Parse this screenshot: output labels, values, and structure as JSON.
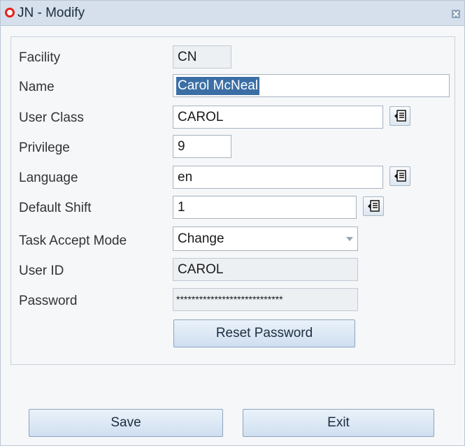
{
  "window": {
    "title": "JN - Modify"
  },
  "form": {
    "facility": {
      "label": "Facility",
      "value": "CN"
    },
    "name": {
      "label": "Name",
      "value": "Carol McNeal"
    },
    "user_class": {
      "label": "User Class",
      "value": "CAROL"
    },
    "privilege": {
      "label": "Privilege",
      "value": "9"
    },
    "language": {
      "label": "Language",
      "value": "en"
    },
    "default_shift": {
      "label": "Default Shift",
      "value": "1"
    },
    "task_accept_mode": {
      "label": "Task Accept Mode",
      "value": "Change"
    },
    "user_id": {
      "label": "User ID",
      "value": "CAROL"
    },
    "password": {
      "label": "Password",
      "value": "****************************"
    },
    "reset_password_label": "Reset Password"
  },
  "footer": {
    "save_label": "Save",
    "exit_label": "Exit"
  },
  "icons": {
    "app_logo": "oracle-logo-icon",
    "close": "close-icon",
    "lov": "list-of-values-icon",
    "dropdown": "chevron-down-icon"
  },
  "colors": {
    "title_bar": "#d5e0ec",
    "selection": "#3b6ea5",
    "brand_red": "#e2231a"
  }
}
